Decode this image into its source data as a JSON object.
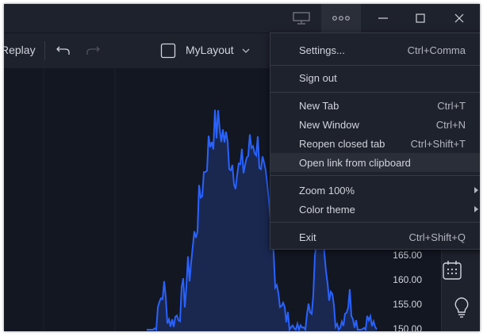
{
  "toolbar": {
    "replay_label": "Replay",
    "layout_name": "MyLayout"
  },
  "chart": {
    "price_labels": [
      "165.00",
      "160.00",
      "155.00",
      "150.00"
    ],
    "line_color": "#2962ff"
  },
  "menu": {
    "items": [
      {
        "label": "Settings...",
        "shortcut": "Ctrl+Comma"
      },
      {
        "label": "Sign out",
        "shortcut": ""
      },
      {
        "label": "New Tab",
        "shortcut": "Ctrl+T"
      },
      {
        "label": "New Window",
        "shortcut": "Ctrl+N"
      },
      {
        "label": "Reopen closed tab",
        "shortcut": "Ctrl+Shift+T"
      },
      {
        "label": "Open link from clipboard",
        "shortcut": ""
      },
      {
        "label": "Zoom 100%",
        "shortcut": ""
      },
      {
        "label": "Color theme",
        "shortcut": ""
      },
      {
        "label": "Exit",
        "shortcut": "Ctrl+Shift+Q"
      }
    ]
  },
  "icons": {
    "monitor": "monitor-icon",
    "more": "more-icon",
    "minimize": "minimize-icon",
    "maximize": "maximize-icon",
    "close": "close-icon",
    "undo": "undo-icon",
    "redo": "redo-icon",
    "layout": "layout-square-icon",
    "chevron": "chevron-down-icon",
    "calendar": "calendar-icon",
    "lightbulb": "lightbulb-icon"
  }
}
